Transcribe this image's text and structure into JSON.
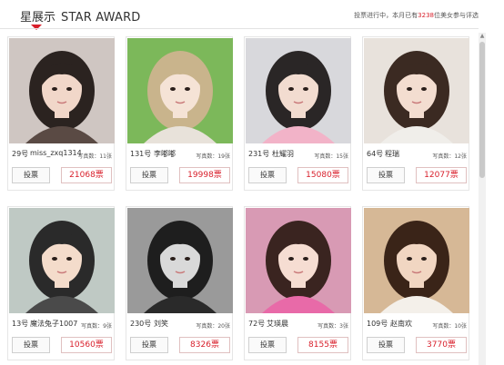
{
  "header": {
    "title_cn": "星展示",
    "title_en": "STAR AWARD",
    "status_prefix": "投票进行中，本月已有",
    "status_count": "3238",
    "status_suffix": "位美女参与评选"
  },
  "vote_label": "投票",
  "cards": [
    {
      "number": "29号",
      "name": "miss_zxq1314",
      "photos": "写真数：11张",
      "votes": "21068票",
      "palette": {
        "bg": "#cfc6c2",
        "hair": "#2b2320",
        "skin": "#f1d7c9",
        "top": "#5a4a44"
      }
    },
    {
      "number": "131号",
      "name": "李嘟嘟",
      "photos": "写真数：19张",
      "votes": "19998票",
      "palette": {
        "bg": "#7cb85a",
        "hair": "#c9b48c",
        "skin": "#f5e3d6",
        "top": "#e8e2da"
      }
    },
    {
      "number": "231号",
      "name": "杜耀羽",
      "photos": "写真数：15张",
      "votes": "15080票",
      "palette": {
        "bg": "#d8d8dc",
        "hair": "#2a2626",
        "skin": "#f2dcd0",
        "top": "#f2b3c8"
      }
    },
    {
      "number": "64号",
      "name": "程瑞",
      "photos": "写真数：12张",
      "votes": "12077票",
      "palette": {
        "bg": "#e8e2dc",
        "hair": "#3b2a22",
        "skin": "#f3ddd0",
        "top": "#f0eeea"
      }
    },
    {
      "number": "13号",
      "name": "魔法兔子1007",
      "photos": "写真数：9张",
      "votes": "10560票",
      "palette": {
        "bg": "#bfc9c4",
        "hair": "#2a2a2a",
        "skin": "#f4dccb",
        "top": "#4a4a4a"
      }
    },
    {
      "number": "230号",
      "name": "刘笑",
      "photos": "写真数：20张",
      "votes": "8326票",
      "palette": {
        "bg": "#9a9a9a",
        "hair": "#1e1e1e",
        "skin": "#d9d9d9",
        "top": "#2a2a2a"
      }
    },
    {
      "number": "72号",
      "name": "艾瑛晨",
      "photos": "写真数：3张",
      "votes": "8155票",
      "palette": {
        "bg": "#d89ab4",
        "hair": "#3a2420",
        "skin": "#f6ddd2",
        "top": "#e86aa8"
      }
    },
    {
      "number": "109号",
      "name": "赵南欢",
      "photos": "写真数：10张",
      "votes": "3770票",
      "palette": {
        "bg": "#d6b896",
        "hair": "#3a2418",
        "skin": "#f1d6c2",
        "top": "#f4f0ea"
      }
    }
  ]
}
